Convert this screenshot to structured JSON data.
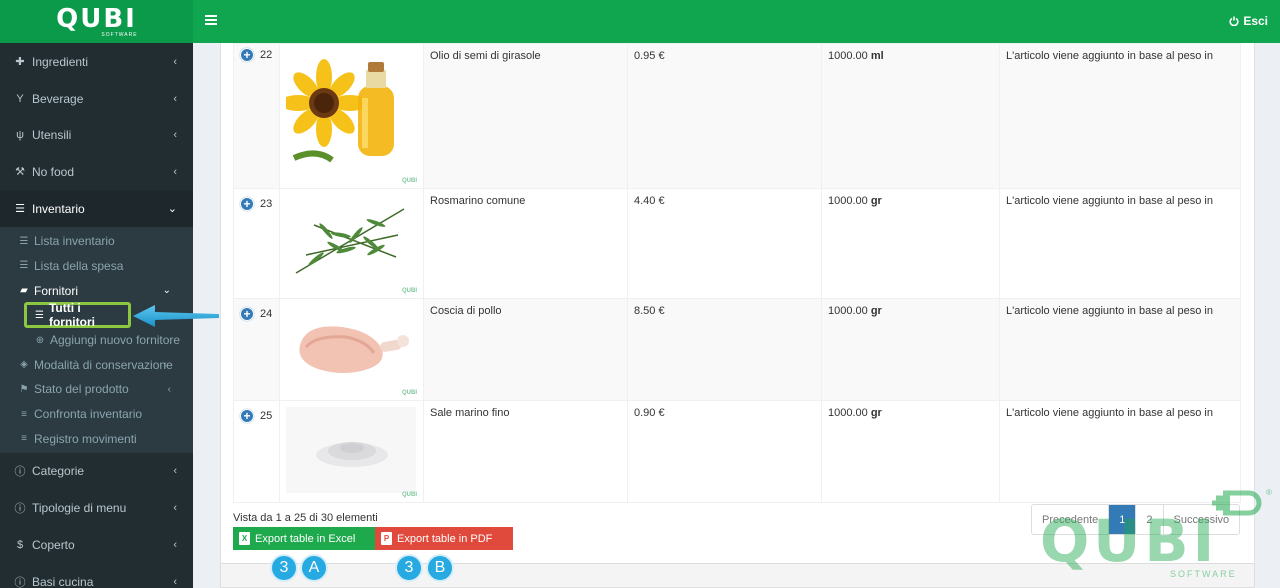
{
  "brand": {
    "logo": "QUBI",
    "logo_sub": "SOFTWARE"
  },
  "header": {
    "menu_icon": "hamburger-icon",
    "logout_label": "Esci"
  },
  "sidebar": {
    "items_top": [
      {
        "label": "Ingredienti",
        "icon": "puzzle-icon"
      },
      {
        "label": "Beverage",
        "icon": "glass-icon"
      },
      {
        "label": "Utensili",
        "icon": "cutlery-icon"
      },
      {
        "label": "No food",
        "icon": "wrench-icon"
      }
    ],
    "inventario": {
      "label": "Inventario",
      "icon": "table-icon"
    },
    "inventario_sub": [
      {
        "label": "Lista inventario"
      },
      {
        "label": "Lista della spesa"
      }
    ],
    "fornitori": {
      "label": "Fornitori"
    },
    "fornitori_sub": [
      {
        "label": "Tutti i fornitori"
      },
      {
        "label": "Aggiungi nuovo fornitore"
      }
    ],
    "inventario_more": [
      {
        "label": "Modalità di conservazione"
      },
      {
        "label": "Stato del prodotto"
      },
      {
        "label": "Confronta inventario"
      },
      {
        "label": "Registro movimenti"
      }
    ],
    "items_bottom": [
      {
        "label": "Categorie",
        "icon": "info-icon"
      },
      {
        "label": "Tipologie di menu",
        "icon": "info-icon"
      },
      {
        "label": "Coperto",
        "icon": "dollar-icon"
      },
      {
        "label": "Basi cucina",
        "icon": "info-icon"
      }
    ]
  },
  "table": {
    "rows": [
      {
        "id": "22",
        "name": "Olio di semi di girasole",
        "price": "0.95 €",
        "qty": "1000.00",
        "unit": "ml",
        "note": "L'articolo viene aggiunto in base al peso in"
      },
      {
        "id": "23",
        "name": "Rosmarino comune",
        "price": "4.40 €",
        "qty": "1000.00",
        "unit": "gr",
        "note": "L'articolo viene aggiunto in base al peso in"
      },
      {
        "id": "24",
        "name": "Coscia di pollo",
        "price": "8.50 €",
        "qty": "1000.00",
        "unit": "gr",
        "note": "L'articolo viene aggiunto in base al peso in"
      },
      {
        "id": "25",
        "name": "Sale marino fino",
        "price": "0.90 €",
        "qty": "1000.00",
        "unit": "gr",
        "note": "L'articolo viene aggiunto in base al peso in"
      }
    ],
    "thumb_watermark": "QUBI"
  },
  "footer": {
    "summary": "Vista da 1 a 25 di 30 elementi",
    "export_excel": "Export table in Excel",
    "export_pdf": "Export table in PDF",
    "badges": [
      "3",
      "A",
      "3",
      "B"
    ]
  },
  "pagination": {
    "prev": "Precedente",
    "pages": [
      "1",
      "2"
    ],
    "current": "1",
    "next": "Successivo"
  },
  "colors": {
    "brand_green": "#10a54f",
    "sidebar": "#222d32",
    "highlight": "#8bc83f",
    "arrow": "#27a9e1"
  }
}
